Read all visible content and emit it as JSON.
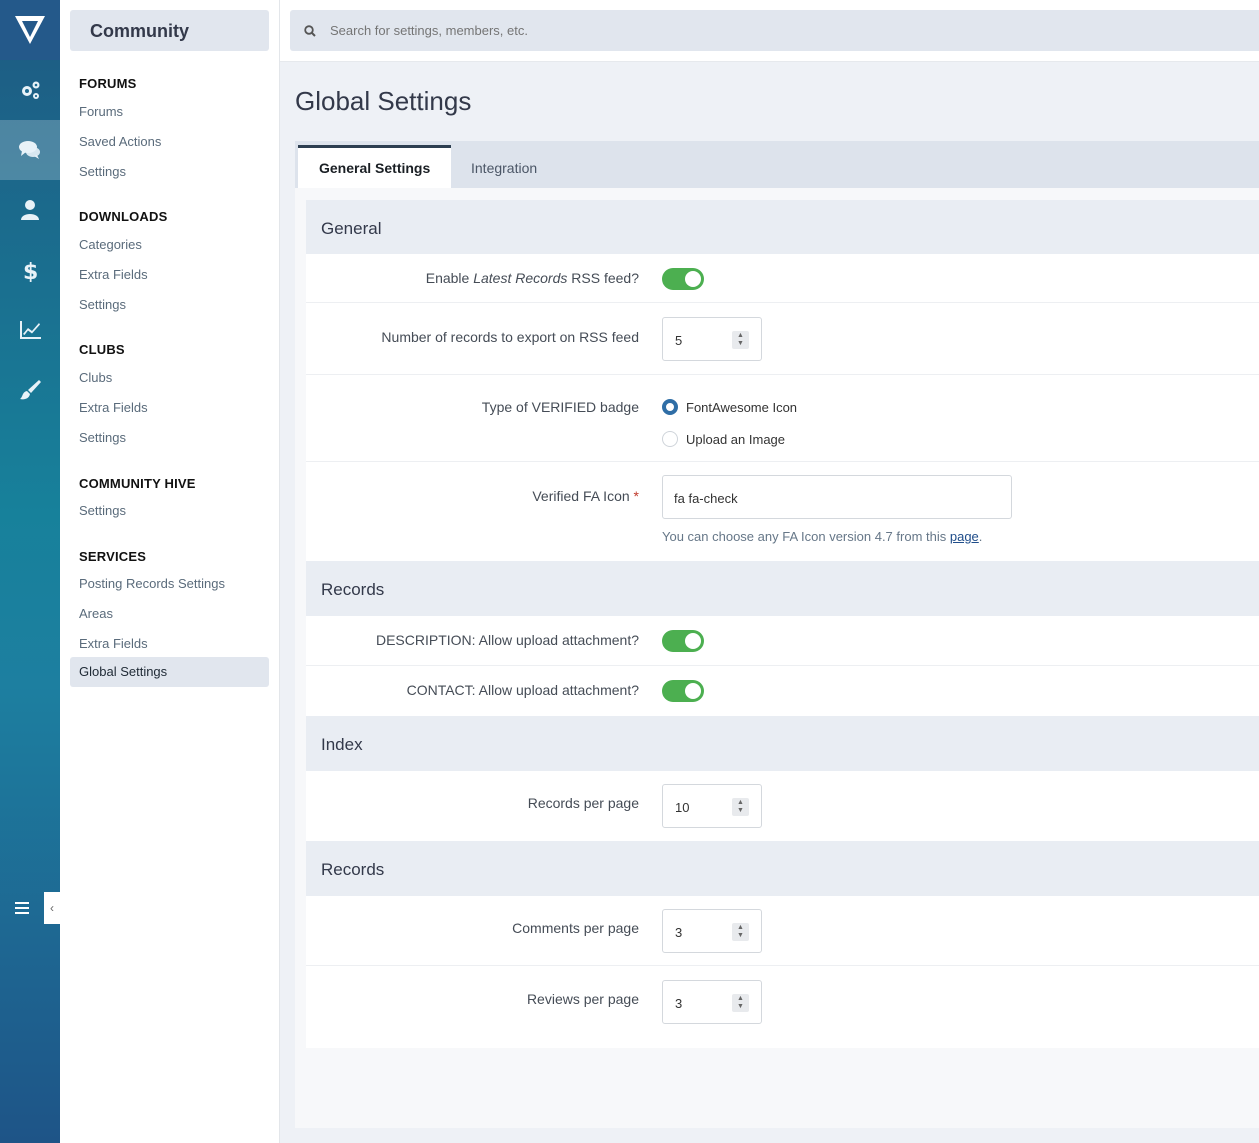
{
  "app": {
    "title": "Community"
  },
  "search": {
    "placeholder": "Search for settings, members, etc."
  },
  "rail": {
    "icons": [
      "logo-icon",
      "gears-icon",
      "comments-icon",
      "user-icon",
      "dollar-icon",
      "chart-icon",
      "brush-icon"
    ],
    "active": "comments-icon",
    "colors": {
      "top": "#1e5a82",
      "middle": "#17819b",
      "bottom": "#1e5487"
    }
  },
  "sidebar": {
    "sections": [
      {
        "title": "FORUMS",
        "items": [
          "Forums",
          "Saved Actions",
          "Settings"
        ]
      },
      {
        "title": "DOWNLOADS",
        "items": [
          "Categories",
          "Extra Fields",
          "Settings"
        ]
      },
      {
        "title": "CLUBS",
        "items": [
          "Clubs",
          "Extra Fields",
          "Settings"
        ]
      },
      {
        "title": "COMMUNITY HIVE",
        "items": [
          "Settings"
        ]
      },
      {
        "title": "SERVICES",
        "items": [
          "Posting Records Settings",
          "Areas",
          "Extra Fields",
          "Global Settings"
        ]
      }
    ],
    "selected": "Global Settings"
  },
  "page": {
    "title": "Global Settings",
    "tabs": [
      "General Settings",
      "Integration"
    ],
    "active_tab": "General Settings"
  },
  "groups": [
    {
      "title": "General",
      "fields": [
        {
          "label_pre": "Enable ",
          "label_em": "Latest Records",
          "label_post": " RSS feed?",
          "type": "toggle",
          "value": true
        },
        {
          "label": "Number of records to export on RSS feed",
          "type": "number",
          "value": "5"
        },
        {
          "label": "Type of VERIFIED badge",
          "type": "radio",
          "options": [
            "FontAwesome Icon",
            "Upload an Image"
          ],
          "selected": "FontAwesome Icon"
        },
        {
          "label": "Verified FA Icon",
          "required_mark": "*",
          "type": "text",
          "value": "fa fa-check",
          "hint_pre": "You can choose any FA Icon version 4.7 from this ",
          "hint_link": "page",
          "hint_post": "."
        }
      ]
    },
    {
      "title": "Records",
      "fields": [
        {
          "label": "DESCRIPTION: Allow upload attachment?",
          "type": "toggle",
          "value": true
        },
        {
          "label": "CONTACT: Allow upload attachment?",
          "type": "toggle",
          "value": true
        }
      ]
    },
    {
      "title": "Index",
      "fields": [
        {
          "label": "Records per page",
          "type": "number",
          "value": "10"
        }
      ]
    },
    {
      "title": "Records",
      "fields": [
        {
          "label": "Comments per page",
          "type": "number",
          "value": "3"
        },
        {
          "label": "Reviews per page",
          "type": "number",
          "value": "3"
        }
      ]
    }
  ],
  "colors": {
    "toggle_on": "#4caf50",
    "radio_selected": "#2f6ea6",
    "required": "#c0392b",
    "link": "#1f4d8a"
  }
}
